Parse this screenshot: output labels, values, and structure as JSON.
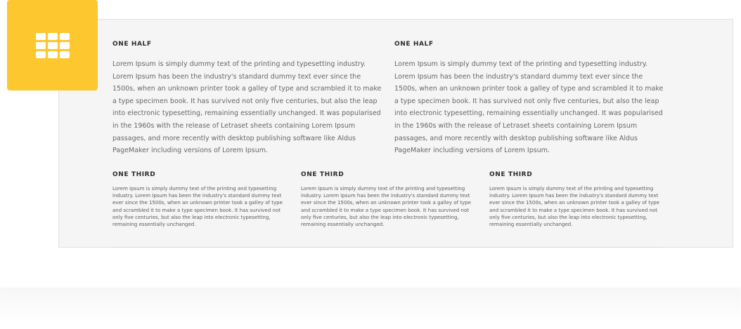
{
  "badge": {
    "icon": "grid-icon",
    "color": "#fcc72f"
  },
  "columns": {
    "half_left": {
      "title": "ONE HALF",
      "text": "Lorem Ipsum is simply dummy text of the printing and typesetting industry. Lorem Ipsum has been the industry's standard dummy text ever since the 1500s, when an unknown printer took a galley of type and scrambled it to make a type specimen book. It has survived not only five centuries, but also the leap into electronic typesetting, remaining essentially unchanged. It was popularised in the 1960s with the release of Letraset sheets containing Lorem Ipsum passages, and more recently with desktop publishing software like Aldus PageMaker including versions of Lorem Ipsum."
    },
    "half_right": {
      "title": "ONE HALF",
      "text": "Lorem Ipsum is simply dummy text of the printing and typesetting industry. Lorem Ipsum has been the industry's standard dummy text ever since the 1500s, when an unknown printer took a galley of type and scrambled it to make a type specimen book. It has survived not only five centuries, but also the leap into electronic typesetting, remaining essentially unchanged. It was popularised in the 1960s with the release of Letraset sheets containing Lorem Ipsum passages, and more recently with desktop publishing software like Aldus PageMaker including versions of Lorem Ipsum."
    },
    "third_1": {
      "title": "ONE THIRD",
      "text": "Lorem Ipsum is simply dummy text of the printing and typesetting industry. Lorem Ipsum has been the industry's standard dummy text ever since the 1500s, when an unknown printer took a galley of type and scrambled it to make a type specimen book. It has survived not only five centuries, but also the leap into electronic typesetting, remaining essentially unchanged."
    },
    "third_2": {
      "title": "ONE THIRD",
      "text": "Lorem Ipsum is simply dummy text of the printing and typesetting industry. Lorem Ipsum has been the industry's standard dummy text ever since the 1500s, when an unknown printer took a galley of type and scrambled it to make a type specimen book. It has survived not only five centuries, but also the leap into electronic typesetting, remaining essentially unchanged."
    },
    "third_3": {
      "title": "ONE THIRD",
      "text": "Lorem Ipsum is simply dummy text of the printing and typesetting industry. Lorem Ipsum has been the industry's standard dummy text ever since the 1500s, when an unknown printer took a galley of type and scrambled it to make a type specimen book. It has survived not only five centuries, but also the leap into electronic typesetting, remaining essentially unchanged."
    }
  }
}
